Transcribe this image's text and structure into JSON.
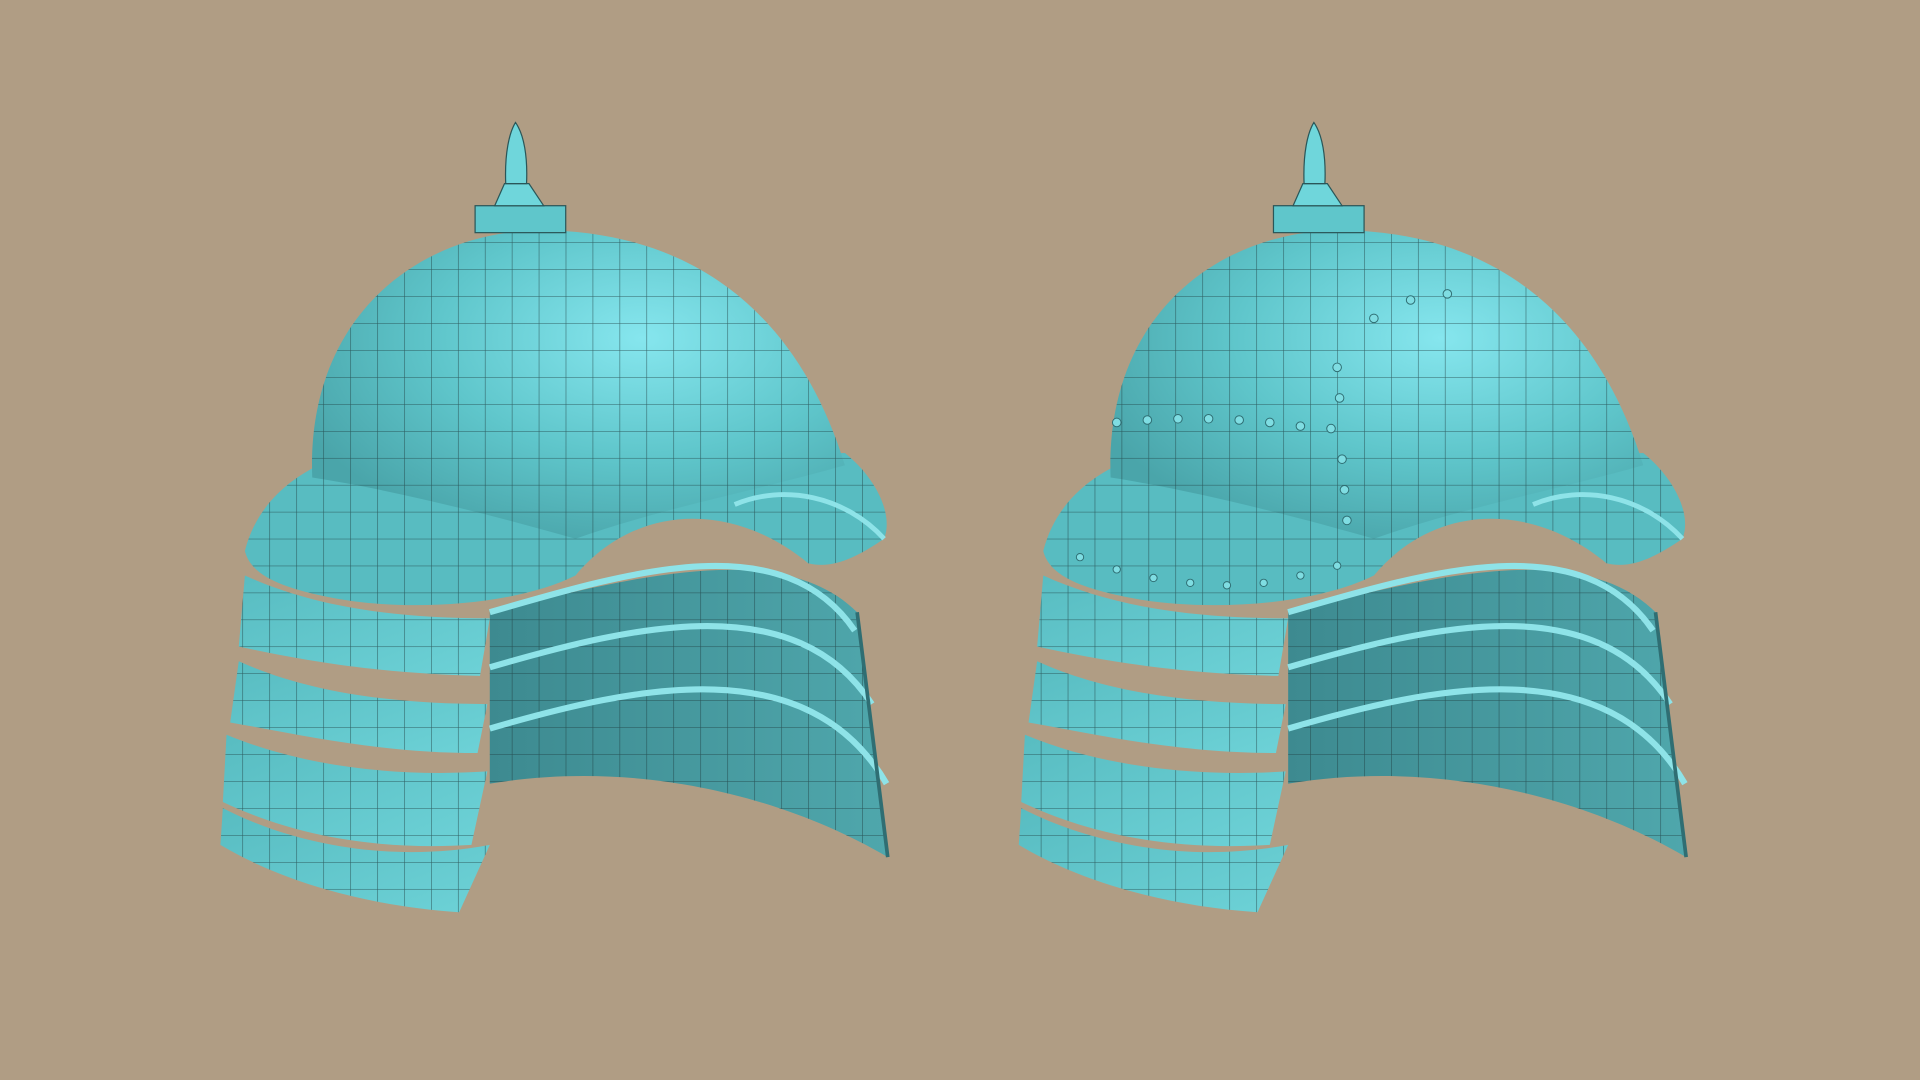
{
  "scene": {
    "background_color": "#b09d84",
    "model_color": "#5fc6cb",
    "model_highlight": "#86e6ee",
    "model_shadow": "#3f8f95",
    "wire_color": "#1d3b3d",
    "models": [
      {
        "name": "helmet-wireframe-base",
        "detail": "base-mesh"
      },
      {
        "name": "helmet-detailed-rivets",
        "detail": "rivets"
      }
    ]
  }
}
